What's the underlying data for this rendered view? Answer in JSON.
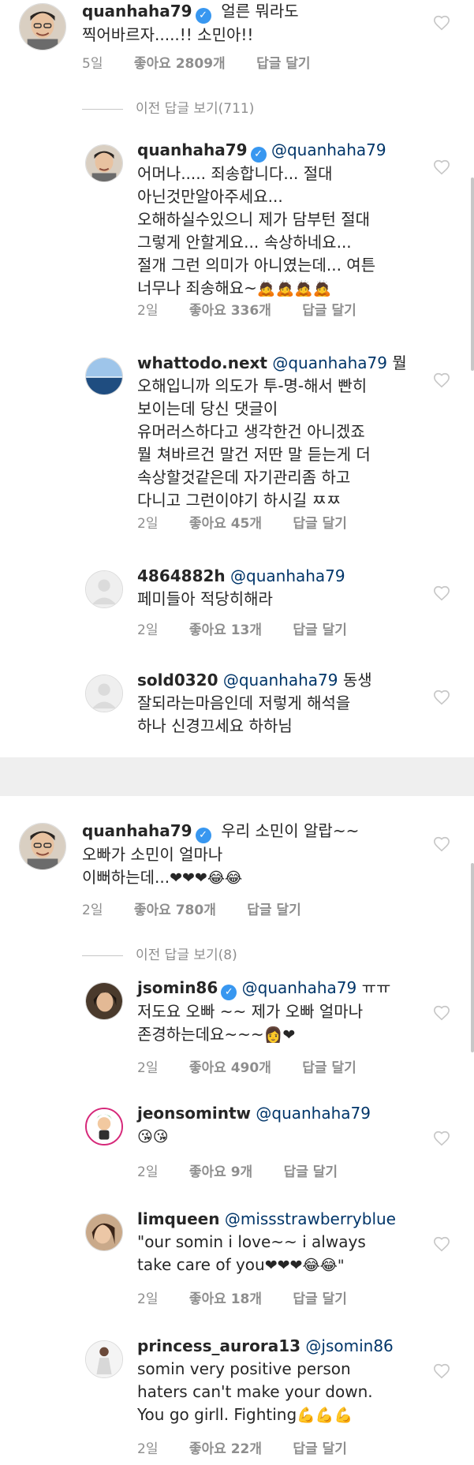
{
  "colors": {
    "accent": "#3897f0",
    "mention": "#003569",
    "muted": "#8e8e8e",
    "heart": "#c7c7c7"
  },
  "thread1": {
    "top": {
      "user": "quanhaha79",
      "verified": true,
      "text": "얼른 뭐라도\n찍어바르자.....!! 소민아!!",
      "time": "5일",
      "likes": "좋아요 2809개",
      "reply": "답글 달기"
    },
    "view_previous": "이전 답글 보기(711)",
    "replies": [
      {
        "user": "quanhaha79",
        "verified": true,
        "mention": "@quanhaha79",
        "text": "\n어머나..... 죄송합니다... 절대\n아닌것만알아주세요...\n오해하실수있으니 제가 담부턴 절대\n그렇게 안할게요... 속상하네요...\n절개 그런 의미가 아니였는데... 여튼\n너무나 죄송해요~",
        "emoji": "🙇🙇🙇🙇",
        "time": "2일",
        "likes": "좋아요 336개",
        "reply": "답글 달기"
      },
      {
        "user": "whattodo.next",
        "verified": false,
        "mention": "@quanhaha79",
        "text": " 뭘\n오해입니까 의도가 투-명-해서 빤히\n보이는데 당신 댓글이\n유머러스하다고 생각한건 아니겠죠\n뭘 쳐바르건 말건 저딴 말 듣는게 더\n속상할것같은데 자기관리좀 하고\n다니고 그런이야기 하시길 ㅉㅉ",
        "emoji": "",
        "time": "2일",
        "likes": "좋아요 45개",
        "reply": "답글 달기"
      },
      {
        "user": "4864882h",
        "verified": false,
        "mention": "@quanhaha79",
        "text": "\n페미들아 적당히해라",
        "emoji": "",
        "time": "2일",
        "likes": "좋아요 13개",
        "reply": "답글 달기"
      },
      {
        "user": "sold0320",
        "verified": false,
        "mention": "@quanhaha79",
        "text": " 동생\n잘되라는마음인데 저렇게 해석을\n하나 신경끄세요 하하님",
        "emoji": "",
        "time": "",
        "likes": "",
        "reply": ""
      }
    ]
  },
  "thread2": {
    "top": {
      "user": "quanhaha79",
      "verified": true,
      "text": "우리 소민이 알랍~~\n오빠가 소민이 얼마나\n이뻐하는데...",
      "emoji": "❤❤❤😂😂",
      "time": "2일",
      "likes": "좋아요 780개",
      "reply": "답글 달기"
    },
    "view_previous": "이전 답글 보기(8)",
    "replies": [
      {
        "user": "jsomin86",
        "verified": true,
        "mention": "@quanhaha79",
        "text": " ㅠㅠ\n저도요 오빠 ~~ 제가 오빠 얼마나\n존경하는데요~~~",
        "emoji": "👩❤",
        "time": "2일",
        "likes": "좋아요 490개",
        "reply": "답글 달기"
      },
      {
        "user": "jeonsomintw",
        "verified": false,
        "mention": "@quanhaha79",
        "text": "\n",
        "emoji": "😘😘",
        "time": "2일",
        "likes": "좋아요 9개",
        "reply": "답글 달기"
      },
      {
        "user": "limqueen",
        "verified": false,
        "mention": "@missstrawberryblue",
        "text": "\n\"our somin i love~~ i always\ntake care of you",
        "emoji": "❤❤❤😂😂\"",
        "time": "2일",
        "likes": "좋아요 18개",
        "reply": "답글 달기"
      },
      {
        "user": "princess_aurora13",
        "verified": false,
        "mention": "@jsomin86",
        "text": "\nsomin very positive person\nhaters can't make your down.\nYou go girll. Fighting",
        "emoji": "💪💪💪",
        "time": "2일",
        "likes": "좋아요 22개",
        "reply": "답글 달기"
      }
    ]
  }
}
